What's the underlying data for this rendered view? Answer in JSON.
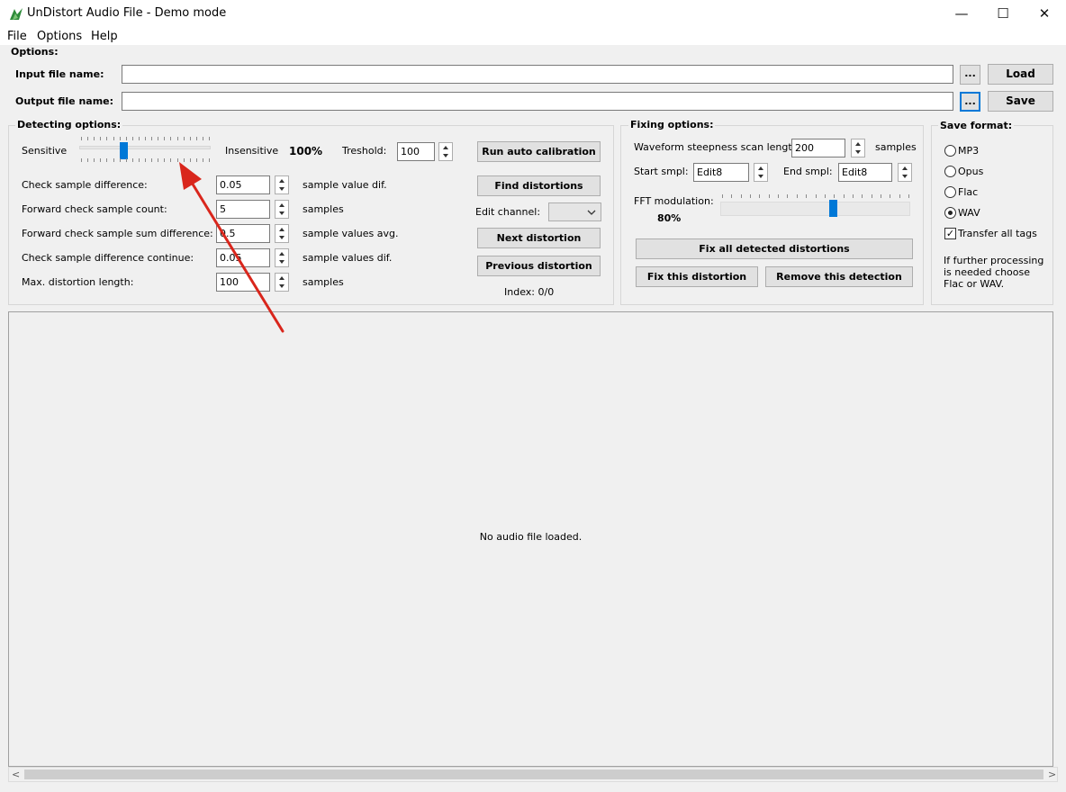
{
  "window": {
    "title": "UnDistort Audio File - Demo mode",
    "controls": {
      "minimize": "—",
      "maximize": "☐",
      "close": "✕"
    }
  },
  "menu": [
    "File",
    "Options",
    "Help"
  ],
  "options": {
    "label": "Options:",
    "input_label": "Input file name:",
    "input_value": "",
    "output_label": "Output file name:",
    "output_value": "",
    "browse": "...",
    "load": "Load",
    "save": "Save"
  },
  "detecting": {
    "label": "Detecting options:",
    "sensitive": "Sensitive",
    "insensitive": "Insensitive",
    "sensitivity_value": "100%",
    "sensitivity_level": 0.33,
    "treshold_label": "Treshold:",
    "treshold_value": "100",
    "rows": [
      {
        "label": "Check sample difference:",
        "value": "0.05",
        "unit": "sample value dif."
      },
      {
        "label": "Forward check sample count:",
        "value": "5",
        "unit": "samples"
      },
      {
        "label": "Forward check sample sum difference:",
        "value": "0.5",
        "unit": "sample values avg."
      },
      {
        "label": "Check sample difference continue:",
        "value": "0.05",
        "unit": "sample values dif."
      },
      {
        "label": "Max. distortion length:",
        "value": "100",
        "unit": "samples"
      }
    ],
    "run_auto_calibration": "Run auto calibration",
    "find_distortions": "Find distortions",
    "edit_channel": "Edit channel:",
    "edit_channel_value": "",
    "next_distortion": "Next distortion",
    "previous_distortion": "Previous distortion",
    "index": "Index: 0/0"
  },
  "fixing": {
    "label": "Fixing options:",
    "waveform_label": "Waveform steepness scan length:",
    "waveform_value": "200",
    "waveform_unit": "samples",
    "start_label": "Start smpl:",
    "start_value": "Edit8",
    "end_label": "End smpl:",
    "end_value": "Edit8",
    "fft_label": "FFT modulation:",
    "fft_value": "80%",
    "fft_level": 0.6,
    "fix_all": "Fix all detected distortions",
    "fix_this": "Fix this distortion",
    "remove_this": "Remove this detection"
  },
  "save_format": {
    "label": "Save format:",
    "formats": [
      "MP3",
      "Opus",
      "Flac",
      "WAV"
    ],
    "selected": "WAV",
    "transfer_label": "Transfer all tags",
    "transfer_checked": true,
    "note": "If further processing is needed choose Flac or WAV."
  },
  "display": {
    "message": "No audio file loaded."
  },
  "scrollbar": {
    "left": "<",
    "right": ">"
  },
  "colors": {
    "accent": "#0078d7",
    "annotation_arrow": "#d9261c"
  }
}
